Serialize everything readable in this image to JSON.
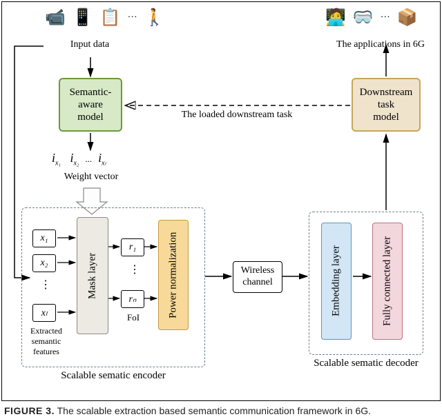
{
  "captions": {
    "input_data": "Input data",
    "apps_6g": "The applications in 6G",
    "weight_vector": "Weight vector",
    "loaded_task": "The loaded downstream task",
    "wireless": "Wireless channel",
    "foi": "FoI",
    "extracted_features": "Extracted\nsemantic\nfeatures",
    "encoder_title": "Scalable sematic encoder",
    "decoder_title": "Scalable sematic decoder",
    "figure": "FIGURE 3.",
    "figure_text": "The scalable extraction based semantic communication framework in 6G."
  },
  "blocks": {
    "semantic_aware": "Semantic-\naware\nmodel",
    "downstream": "Downstream\ntask\nmodel",
    "mask_layer": "Mask layer",
    "power_norm": "Power normalization",
    "embedding": "Embedding layer",
    "fully_connected": "Fully connected layer"
  },
  "features_x": [
    "x₁",
    "x₂",
    "xₗ"
  ],
  "features_r": [
    "r₁",
    "rₙ"
  ],
  "weight_indices": [
    "i",
    "i",
    "i"
  ],
  "weight_subs": [
    "x₁",
    "x₂",
    "xₗ"
  ],
  "icons": {
    "input": [
      "📹",
      "📱",
      "📋",
      "🚶"
    ],
    "apps": [
      "🧑‍💻",
      "🥽",
      "📦"
    ]
  }
}
